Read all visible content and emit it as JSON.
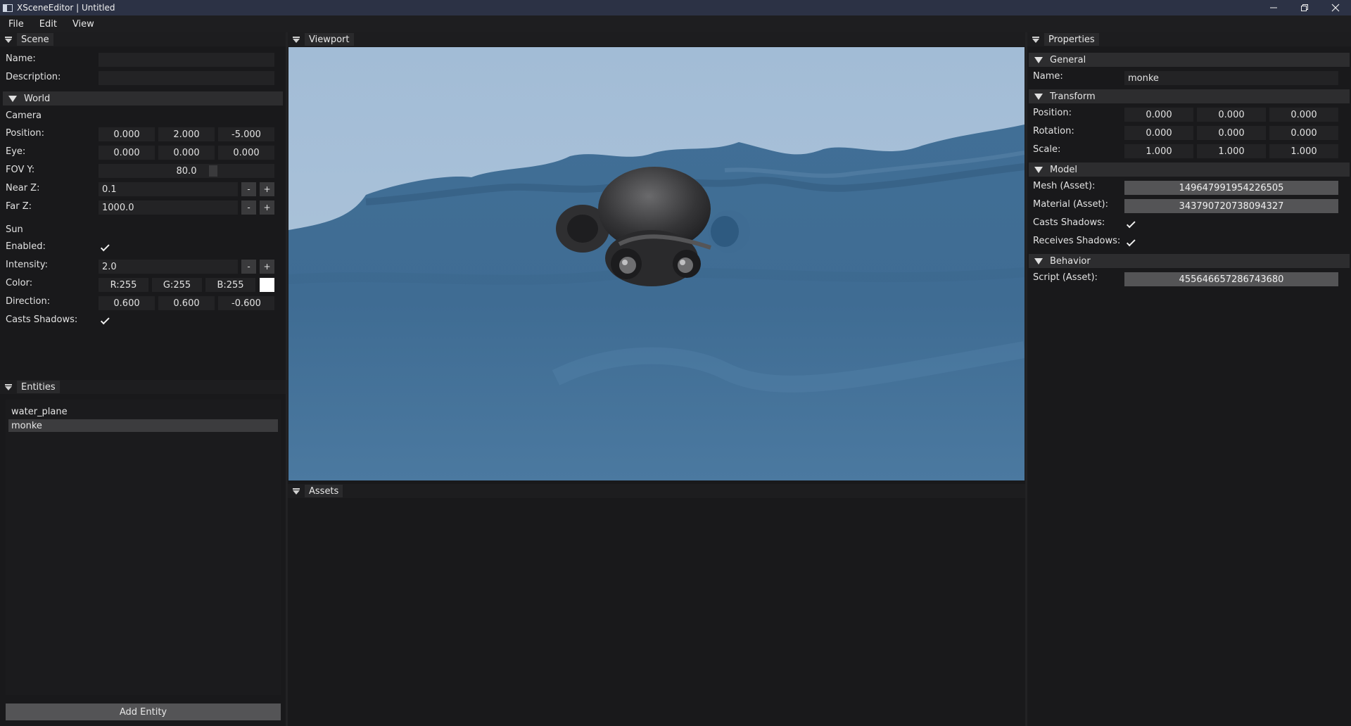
{
  "window": {
    "title": "XSceneEditor | Untitled"
  },
  "menu": [
    "File",
    "Edit",
    "View"
  ],
  "scene_panel": {
    "tab": "Scene",
    "name_label": "Name:",
    "name_value": "",
    "description_label": "Description:",
    "description_value": "",
    "world_section": "World",
    "camera_heading": "Camera",
    "position_label": "Position:",
    "position": [
      "0.000",
      "2.000",
      "-5.000"
    ],
    "eye_label": "Eye:",
    "eye": [
      "0.000",
      "0.000",
      "0.000"
    ],
    "fov_label": "FOV Y:",
    "fov_value": "80.0",
    "near_label": "Near Z:",
    "near_value": "0.1",
    "far_label": "Far Z:",
    "far_value": "1000.0",
    "sun_heading": "Sun",
    "enabled_label": "Enabled:",
    "enabled": true,
    "intensity_label": "Intensity:",
    "intensity_value": "2.0",
    "color_label": "Color:",
    "color_r": "R:255",
    "color_g": "G:255",
    "color_b": "B:255",
    "color_swatch": "#ffffff",
    "direction_label": "Direction:",
    "direction": [
      "0.600",
      "0.600",
      "-0.600"
    ],
    "casts_shadows_label": "Casts Shadows:",
    "casts_shadows": true,
    "minus": "-",
    "plus": "+"
  },
  "entities_panel": {
    "tab": "Entities",
    "items": [
      "water_plane",
      "monke"
    ],
    "selected": "monke",
    "add_button": "Add Entity"
  },
  "viewport_panel": {
    "tab": "Viewport"
  },
  "assets_panel": {
    "tab": "Assets"
  },
  "properties_panel": {
    "tab": "Properties",
    "general_section": "General",
    "name_label": "Name:",
    "name_value": "monke",
    "transform_section": "Transform",
    "position_label": "Position:",
    "position": [
      "0.000",
      "0.000",
      "0.000"
    ],
    "rotation_label": "Rotation:",
    "rotation": [
      "0.000",
      "0.000",
      "0.000"
    ],
    "scale_label": "Scale:",
    "scale": [
      "1.000",
      "1.000",
      "1.000"
    ],
    "model_section": "Model",
    "mesh_label": "Mesh (Asset):",
    "mesh_value": "14964799195422650​5",
    "material_label": "Material (Asset):",
    "material_value": "343790720738094327",
    "casts_label": "Casts Shadows:",
    "casts": true,
    "receives_label": "Receives Shadows:",
    "receives": true,
    "behavior_section": "Behavior",
    "script_label": "Script (Asset):",
    "script_value": "455646657286743680"
  },
  "colors": {
    "titlebar": "#2c3245",
    "panel_bg": "#19191b",
    "section_bg": "#2d2d2f",
    "field_bg": "#232325",
    "asset_field_bg": "#545456",
    "sky": "#a3bdd6",
    "water": "#3d6a90"
  }
}
